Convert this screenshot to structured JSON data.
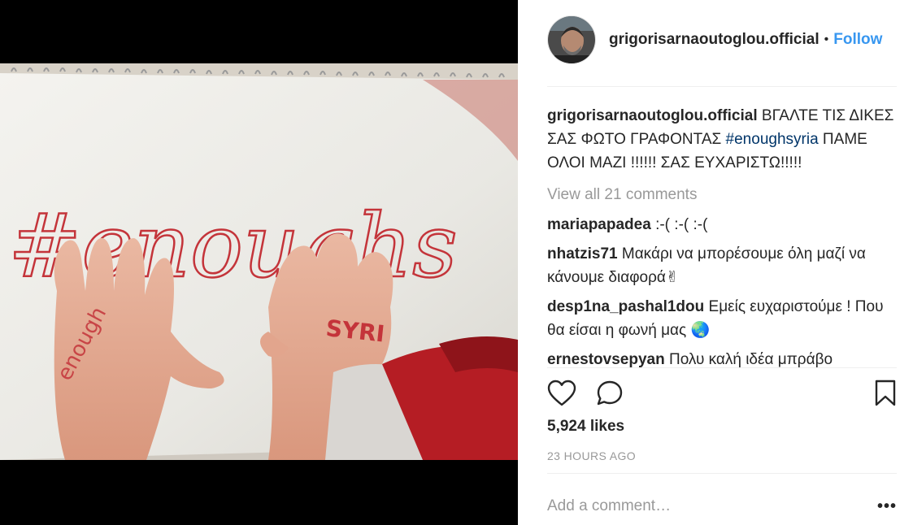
{
  "post": {
    "username": "grigorisarnaoutoglou.official",
    "separator": "•",
    "follow_label": "Follow",
    "caption_prefix": "ΒΓΑΛΤΕ ΤΙΣ ΔΙΚΕΣ ΣΑΣ ΦΩΤΟ ΓΡΑΦΟΝΤΑΣ",
    "caption_hashtag": "#enoughsyria",
    "caption_suffix": "ΠΑΜΕ ΟΛΟΙ ΜΑΖΙ !!!!!! ΣΑΣ ΕΥΧΑΡΙΣΤΩ!!!!!",
    "view_all_comments": "View all 21 comments",
    "likes": "5,924 likes",
    "timestamp": "23 HOURS AGO",
    "add_comment_placeholder": "Add a comment…",
    "more_label": "•••"
  },
  "photo": {
    "hashtag_text": "#enoughs",
    "hand_text": "SYRI"
  },
  "comments": [
    {
      "user": "mariapapadea",
      "text": ":-( :-( :-("
    },
    {
      "user": "nhatzis71",
      "text": "Μακάρι να μπορέσουμε όλη μαζί να κάνουμε διαφορά✌"
    },
    {
      "user": "desp1na_pashal1dou",
      "text": "Εμείς ευχαριστούμε ! Που θα είσαι η φωνή μας 🌏"
    },
    {
      "user": "ernestovsepyan",
      "text": "Πολυ καλή ιδέα μπράβο"
    }
  ],
  "icons": {
    "like": "heart-icon",
    "comment": "comment-bubble-icon",
    "save": "bookmark-icon",
    "more": "more-options-icon"
  },
  "colors": {
    "link": "#3897f0",
    "hashtag": "#003569",
    "muted": "#999999",
    "text": "#262626"
  }
}
